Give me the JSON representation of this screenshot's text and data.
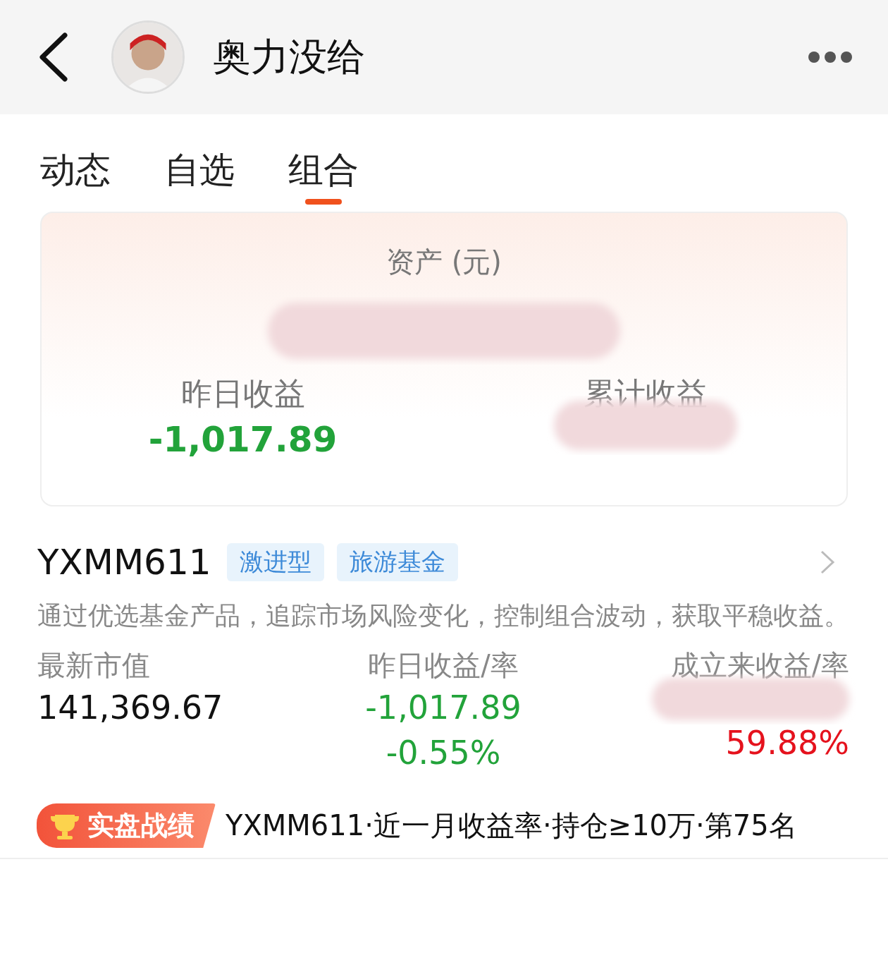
{
  "header": {
    "title": "奥力没给"
  },
  "tabs": [
    {
      "label": "动态",
      "selected": false
    },
    {
      "label": "自选",
      "selected": false
    },
    {
      "label": "组合",
      "selected": true
    }
  ],
  "asset_card": {
    "title": "资产 (元)",
    "amount_redacted": true,
    "items": [
      {
        "label": "昨日收益",
        "value": "-1,017.89",
        "color": "#22a33a",
        "redacted": false
      },
      {
        "label": "累计收益",
        "redacted": true
      }
    ]
  },
  "fund": {
    "name": "YXMM611",
    "tags": [
      "激进型",
      "旅游基金"
    ],
    "description": "通过优选基金产品，追踪市场风险变化，控制组合波动，获取平稳收益。",
    "stats": [
      {
        "label": "最新市值",
        "values": [
          "141,369.67"
        ],
        "color": "#111111",
        "redacted": false
      },
      {
        "label": "昨日收益/率",
        "values": [
          "-1,017.89",
          "-0.55%"
        ],
        "color": "#22a33a",
        "redacted": false
      },
      {
        "label": "成立来收益/率",
        "values": [
          "59.88%"
        ],
        "color": "#e5121d",
        "redacted": true
      }
    ]
  },
  "record": {
    "badge": "实盘战绩",
    "text": "YXMM611·近一月收益率·持仓≥10万·第75名"
  }
}
